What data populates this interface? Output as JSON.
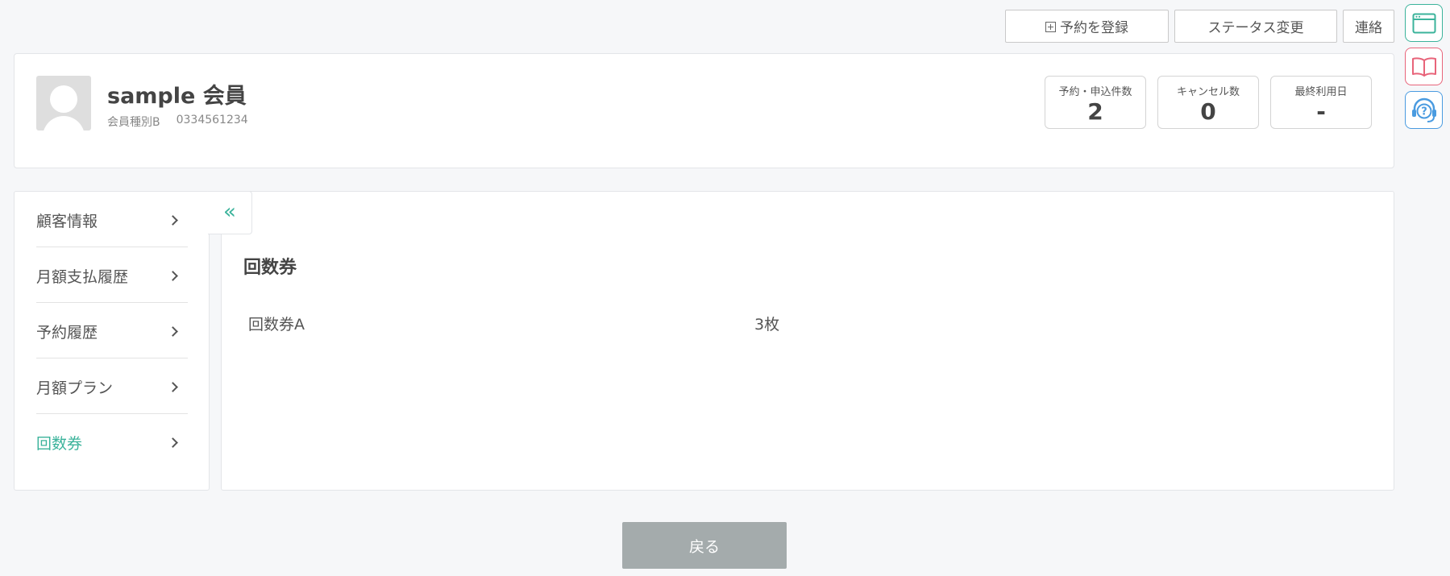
{
  "top_actions": {
    "reserve_label": "予約を登録",
    "status_label": "ステータス変更",
    "contact_label": "連絡"
  },
  "side_tools": [
    "window-icon",
    "book-icon",
    "help-headset-icon"
  ],
  "member": {
    "name": "sample 会員",
    "type": "会員種別B",
    "phone": "0334561234"
  },
  "stats": [
    {
      "label": "予約・申込件数",
      "value": "2"
    },
    {
      "label": "キャンセル数",
      "value": "0"
    },
    {
      "label": "最終利用日",
      "value": "-"
    }
  ],
  "nav": {
    "items": [
      {
        "label": "顧客情報"
      },
      {
        "label": "月額支払履歴"
      },
      {
        "label": "予約履歴"
      },
      {
        "label": "月額プラン"
      },
      {
        "label": "回数券"
      }
    ],
    "active_index": 4,
    "collapse_glyph": "«"
  },
  "section": {
    "title": "回数券",
    "tickets": [
      {
        "name": "回数券A",
        "count": "3枚"
      }
    ]
  },
  "footer": {
    "back_label": "戻る"
  },
  "colors": {
    "accent": "#3bb39b",
    "book": "#e8647a",
    "help": "#4a9be0",
    "back_button": "#a4abac"
  }
}
